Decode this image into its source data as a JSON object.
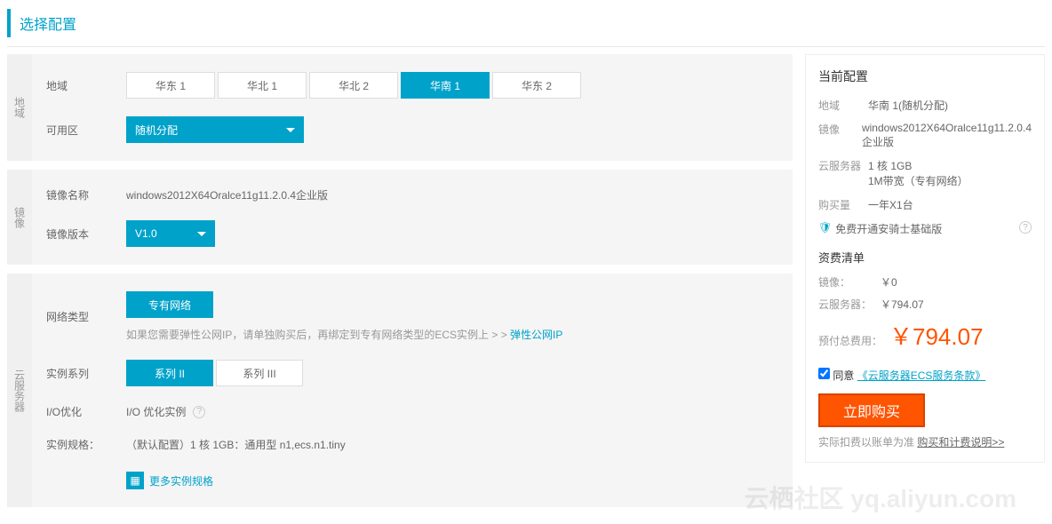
{
  "page_title": "选择配置",
  "sections": {
    "region": {
      "side_label": "地域",
      "region_label": "地域",
      "regions": [
        "华东 1",
        "华北 1",
        "华北 2",
        "华南 1",
        "华东 2"
      ],
      "region_active": "华南 1",
      "zone_label": "可用区",
      "zone_value": "随机分配"
    },
    "image": {
      "side_label": "镜像",
      "name_label": "镜像名称",
      "name_value": "windows2012X64Oralce11g11.2.0.4企业版",
      "version_label": "镜像版本",
      "version_value": "V1.0"
    },
    "server": {
      "side_label": "云服务器",
      "network_label": "网络类型",
      "network_value": "专有网络",
      "network_hint_prefix": "如果您需要弹性公网IP，请单独购买后，再绑定到专有网络类型的ECS实例上 > > ",
      "network_hint_link": "弹性公网IP",
      "series_label": "实例系列",
      "series_options": [
        "系列 II",
        "系列 III"
      ],
      "series_active": "系列 II",
      "io_label": "I/O优化",
      "io_value": "I/O 优化实例",
      "spec_label": "实例规格：",
      "spec_value": "（默认配置）1 核 1GB：通用型 n1,ecs.n1.tiny",
      "more_spec": "更多实例规格"
    }
  },
  "current_config": {
    "title": "当前配置",
    "region_k": "地域",
    "region_v": "华南 1(随机分配)",
    "image_k": "镜像",
    "image_v": "windows2012X64Oralce11g11.2.0.4企业版",
    "server_k": "云服务器",
    "server_v1": "1 核 1GB",
    "server_v2": "1M带宽（专有网络）",
    "qty_k": "购买量",
    "qty_v": "一年X1台",
    "free_service": "免费开通安骑士基础版"
  },
  "cost": {
    "title": "资费清单",
    "image_k": "镜像：",
    "image_v": "￥0",
    "server_k": "云服务器：",
    "server_v": "￥794.07",
    "total_k": "预付总费用：",
    "total_v": "￥794.07"
  },
  "agree": {
    "label_prefix": "同意",
    "link": "《云服务器ECS服务条款》"
  },
  "buy_label": "立即购买",
  "note_prefix": "实际扣费以账单为准",
  "note_link": "购买和计费说明>>",
  "watermark": "云栖社区 yq.aliyun.com"
}
